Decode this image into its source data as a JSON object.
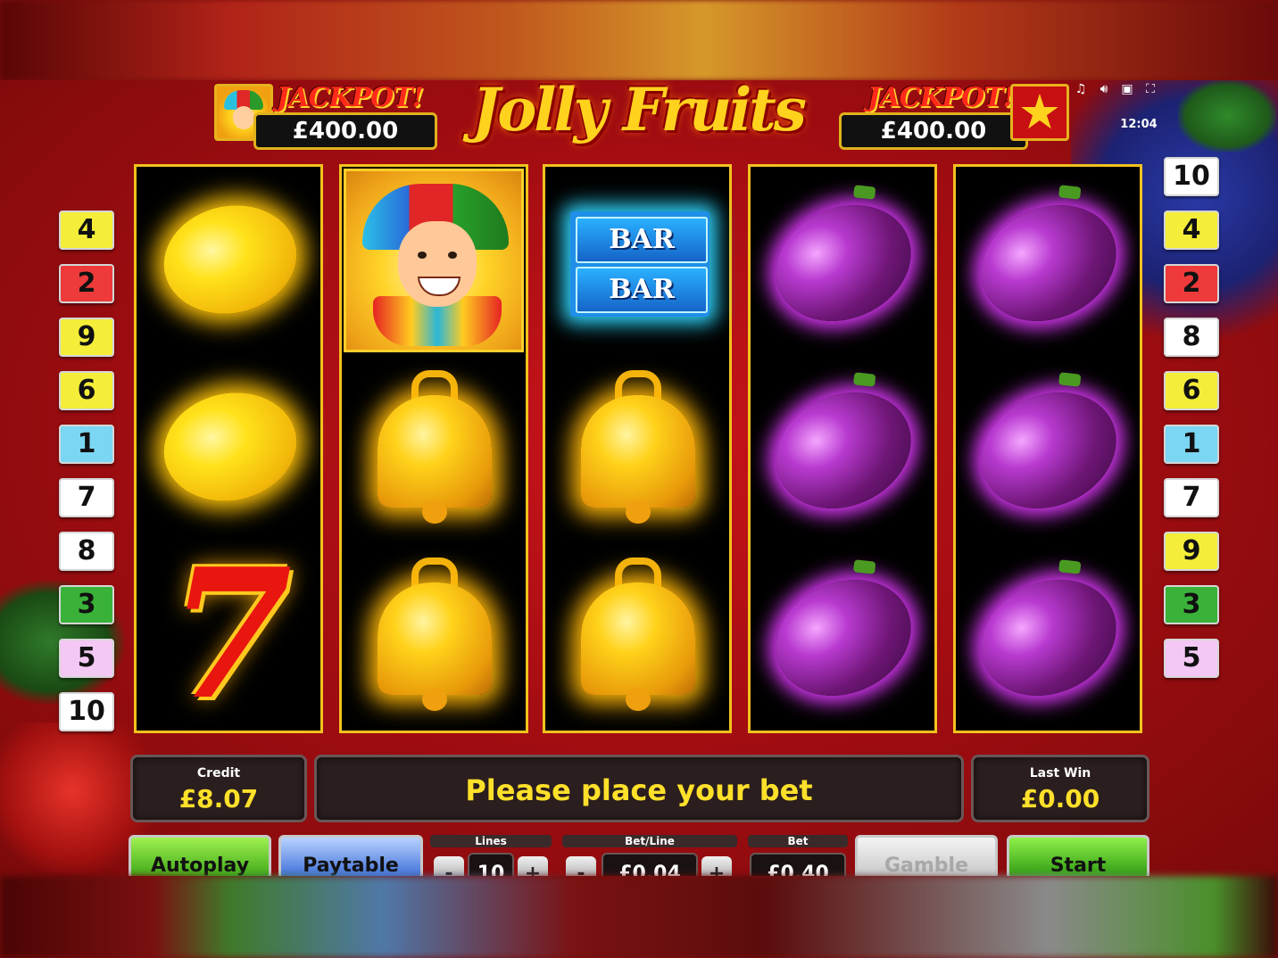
{
  "game": {
    "title": "Jolly Fruits",
    "jackpot_left": {
      "label": "JACKPOT!",
      "value": "£400.00"
    },
    "jackpot_right": {
      "label": "JACKPOT!",
      "value": "£400.00"
    },
    "clock": "12:04",
    "top_icons": [
      "music-icon",
      "sound-icon",
      "settings-icon",
      "fullscreen-icon"
    ]
  },
  "lines_left": [
    {
      "n": "4",
      "color": "#f4ee3a"
    },
    {
      "n": "2",
      "color": "#ee3a3a"
    },
    {
      "n": "9",
      "color": "#f4ee3a"
    },
    {
      "n": "6",
      "color": "#f4ee3a"
    },
    {
      "n": "1",
      "color": "#7ad6f2"
    },
    {
      "n": "7",
      "color": "#ffffff"
    },
    {
      "n": "8",
      "color": "#ffffff"
    },
    {
      "n": "3",
      "color": "#3ab23a"
    },
    {
      "n": "5",
      "color": "#f4c8f4"
    },
    {
      "n": "10",
      "color": "#ffffff"
    }
  ],
  "lines_right": [
    {
      "n": "10",
      "color": "#ffffff"
    },
    {
      "n": "4",
      "color": "#f4ee3a"
    },
    {
      "n": "2",
      "color": "#ee3a3a"
    },
    {
      "n": "8",
      "color": "#ffffff"
    },
    {
      "n": "6",
      "color": "#f4ee3a"
    },
    {
      "n": "1",
      "color": "#7ad6f2"
    },
    {
      "n": "7",
      "color": "#ffffff"
    },
    {
      "n": "9",
      "color": "#f4ee3a"
    },
    {
      "n": "3",
      "color": "#3ab23a"
    },
    {
      "n": "5",
      "color": "#f4c8f4"
    }
  ],
  "reels": [
    [
      "lemon",
      "lemon",
      "seven"
    ],
    [
      "jester",
      "bell",
      "bell"
    ],
    [
      "bar",
      "bell",
      "bell"
    ],
    [
      "plum",
      "plum",
      "plum"
    ],
    [
      "plum",
      "plum",
      "plum"
    ]
  ],
  "bar_text": "BAR",
  "panel": {
    "credit_label": "Credit",
    "credit_value": "£8.07",
    "message": "Please place your bet",
    "last_win_label": "Last Win",
    "last_win_value": "£0.00"
  },
  "controls": {
    "autoplay": "Autoplay",
    "paytable": "Paytable",
    "gamble": "Gamble",
    "start": "Start",
    "lines_label": "Lines",
    "lines_value": "10",
    "bet_line_label": "Bet/Line",
    "bet_line_value": "£0.04",
    "bet_label": "Bet",
    "bet_value": "£0.40",
    "minus": "-",
    "plus": "+"
  }
}
